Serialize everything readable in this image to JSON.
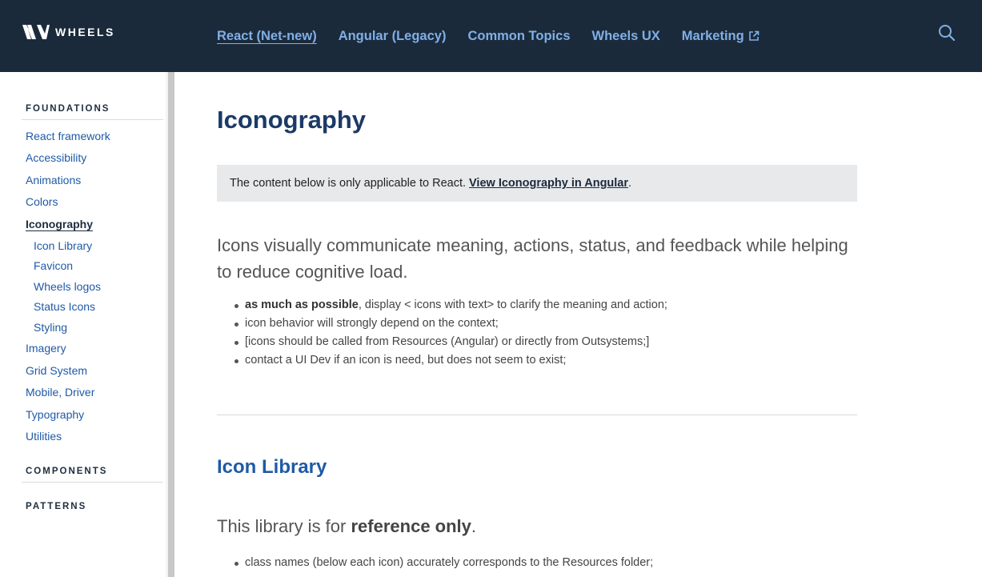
{
  "header": {
    "logo_text": "WHEELS",
    "nav": [
      {
        "label": "React (Net-new)",
        "active": true
      },
      {
        "label": "Angular (Legacy)",
        "active": false
      },
      {
        "label": "Common Topics",
        "active": false
      },
      {
        "label": "Wheels UX",
        "active": false
      },
      {
        "label": "Marketing",
        "active": false,
        "external": true
      }
    ],
    "search_icon": "search-icon"
  },
  "sidebar": {
    "foundations_title": "FOUNDATIONS",
    "items": [
      {
        "label": "React framework"
      },
      {
        "label": "Accessibility"
      },
      {
        "label": "Animations"
      },
      {
        "label": "Colors"
      },
      {
        "label": "Iconography",
        "active": true
      },
      {
        "label": "Icon Library",
        "sub": true
      },
      {
        "label": "Favicon",
        "sub": true
      },
      {
        "label": "Wheels logos",
        "sub": true
      },
      {
        "label": "Status Icons",
        "sub": true
      },
      {
        "label": "Styling",
        "sub": true
      },
      {
        "label": "Imagery"
      },
      {
        "label": "Grid System"
      },
      {
        "label": "Mobile, Driver"
      },
      {
        "label": "Typography"
      },
      {
        "label": "Utilities"
      }
    ],
    "components_title": "COMPONENTS",
    "patterns_title": "PATTERNS"
  },
  "main": {
    "title": "Iconography",
    "notice_text": "The content below is only applicable to React.",
    "notice_link": "View Iconography in Angular",
    "notice_end": ".",
    "lead": "Icons visually communicate meaning, actions, status, and feedback while helping to reduce cognitive load.",
    "bullet1_bold": "as much as possible",
    "bullet1_rest": ", display < icons with text> to clarify the meaning and action;",
    "bullet2": "icon behavior will strongly depend on the context;",
    "bullet3": "[icons should be called from Resources (Angular) or directly from Outsystems;]",
    "bullet4": "contact a UI Dev if an icon is need, but does not seem to exist;",
    "section_title": "Icon Library",
    "lead2_start": "This library is for ",
    "lead2_bold": "reference only",
    "lead2_end": ".",
    "bullet5": "class names (below each icon) accurately corresponds to the Resources folder;"
  },
  "colors": {
    "header_bg": "#1b2a3b",
    "nav_link": "#7fb0e6",
    "link": "#1f5aa6",
    "title": "#1b3a66"
  }
}
